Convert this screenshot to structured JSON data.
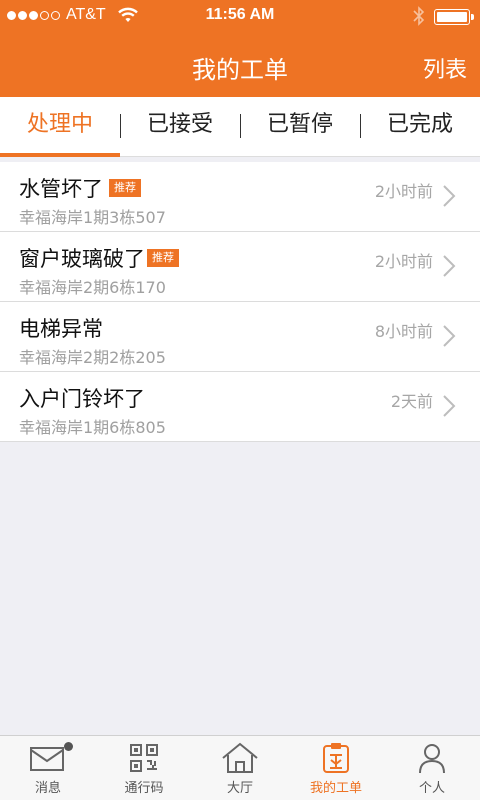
{
  "status_bar": {
    "carrier": "AT&T",
    "time": "11:56 AM"
  },
  "nav": {
    "title": "我的工单",
    "right_label": "列表"
  },
  "tabs": [
    {
      "label": "处理中",
      "active": true
    },
    {
      "label": "已接受",
      "active": false
    },
    {
      "label": "已暂停",
      "active": false
    },
    {
      "label": "已完成",
      "active": false
    }
  ],
  "orders": [
    {
      "title": "水管坏了",
      "tag": "推荐",
      "address": "幸福海岸1期3栋507",
      "time_ago": "2小时前"
    },
    {
      "title": "窗户玻璃破了",
      "tag": "推荐",
      "address": "幸福海岸2期6栋170",
      "time_ago": "2小时前"
    },
    {
      "title": "电梯异常",
      "tag": "",
      "address": "幸福海岸2期2栋205",
      "time_ago": "8小时前"
    },
    {
      "title": "入户门铃坏了",
      "tag": "",
      "address": "幸福海岸1期6栋805",
      "time_ago": "2天前"
    }
  ],
  "tabbar": [
    {
      "label": "消息",
      "icon": "envelope-icon"
    },
    {
      "label": "通行码",
      "icon": "qr-code-icon"
    },
    {
      "label": "大厅",
      "icon": "house-icon"
    },
    {
      "label": "我的工单",
      "icon": "work-order-icon",
      "active": true
    },
    {
      "label": "个人",
      "icon": "person-icon"
    }
  ],
  "colors": {
    "accent": "#ee7324",
    "background": "#efeff4"
  }
}
